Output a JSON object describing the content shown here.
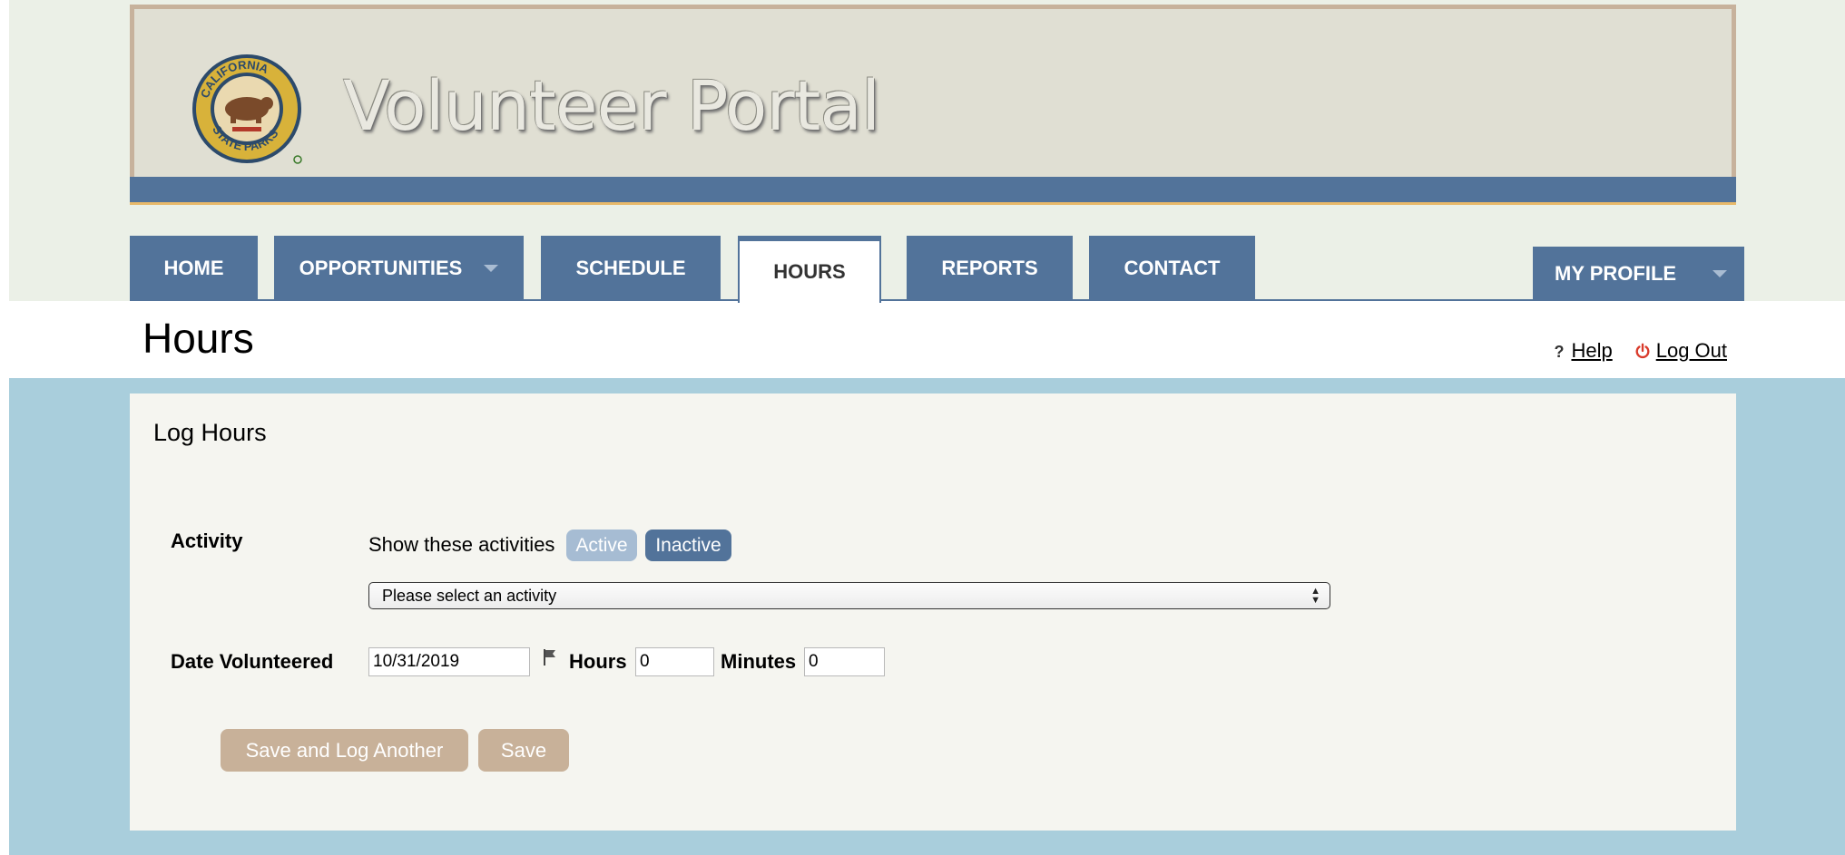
{
  "header": {
    "logo_text": "CALIFORNIA STATE PARKS SINCE 1864",
    "title": "Volunteer Portal"
  },
  "nav": {
    "tabs": [
      {
        "label": "HOME"
      },
      {
        "label": "OPPORTUNITIES"
      },
      {
        "label": "SCHEDULE"
      },
      {
        "label": "HOURS"
      },
      {
        "label": "REPORTS"
      },
      {
        "label": "CONTACT"
      }
    ],
    "active_tab": "HOURS",
    "profile_label": "MY PROFILE"
  },
  "page": {
    "title": "Hours",
    "help_icon": "?",
    "help_label": "Help",
    "logout_label": "Log Out"
  },
  "form": {
    "title": "Log Hours",
    "activity_label": "Activity",
    "show_activities_text": "Show these activities",
    "active_label": "Active",
    "inactive_label": "Inactive",
    "activity_select_value": "Please select an activity",
    "date_label": "Date Volunteered",
    "date_value": "10/31/2019",
    "hours_label": "Hours",
    "hours_value": "0",
    "minutes_label": "Minutes",
    "minutes_value": "0",
    "save_another_label": "Save and Log Another",
    "save_label": "Save"
  },
  "colors": {
    "nav_blue": "#52739a",
    "banner_beige": "#e0dfd3",
    "banner_border": "#c7b29c",
    "page_blue": "#a9cedc",
    "button_tan": "#c8b199",
    "logout_red": "#d93a2b"
  }
}
